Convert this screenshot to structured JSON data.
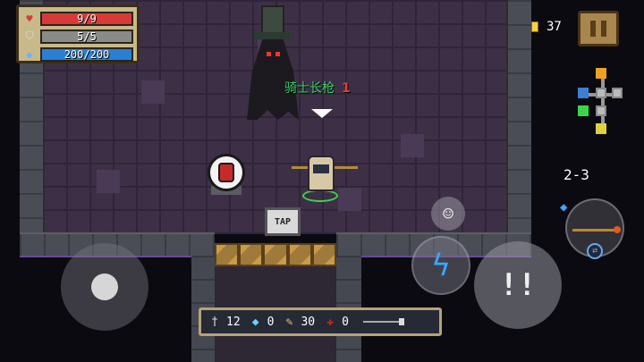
{
  "hud": {
    "health": {
      "icon": "heart-icon",
      "text": "9/9",
      "fraction": 1.0,
      "color": "#d83a3a"
    },
    "armor": {
      "icon": "shield-icon",
      "text": "5/5",
      "fraction": 1.0,
      "color": "#8a8a8a"
    },
    "energy": {
      "icon": "energy-crystal-icon",
      "text": "200/200",
      "fraction": 1.0,
      "color": "#2a7fd4"
    },
    "coins": "37",
    "level": "2-3"
  },
  "world": {
    "weapon_name": "骑士长枪",
    "weapon_level": "1",
    "tap_sign": "TAP"
  },
  "materials": {
    "sword_count": "12",
    "gem_count": "0",
    "feather_count": "30",
    "cross_count": "0"
  },
  "colors": {
    "floor": "#3d3046",
    "wall": "#4a4d55",
    "weapon_label": "#3dd46b",
    "weapon_level": "#e53a3a",
    "skill_icon": "#3aa7ff"
  }
}
